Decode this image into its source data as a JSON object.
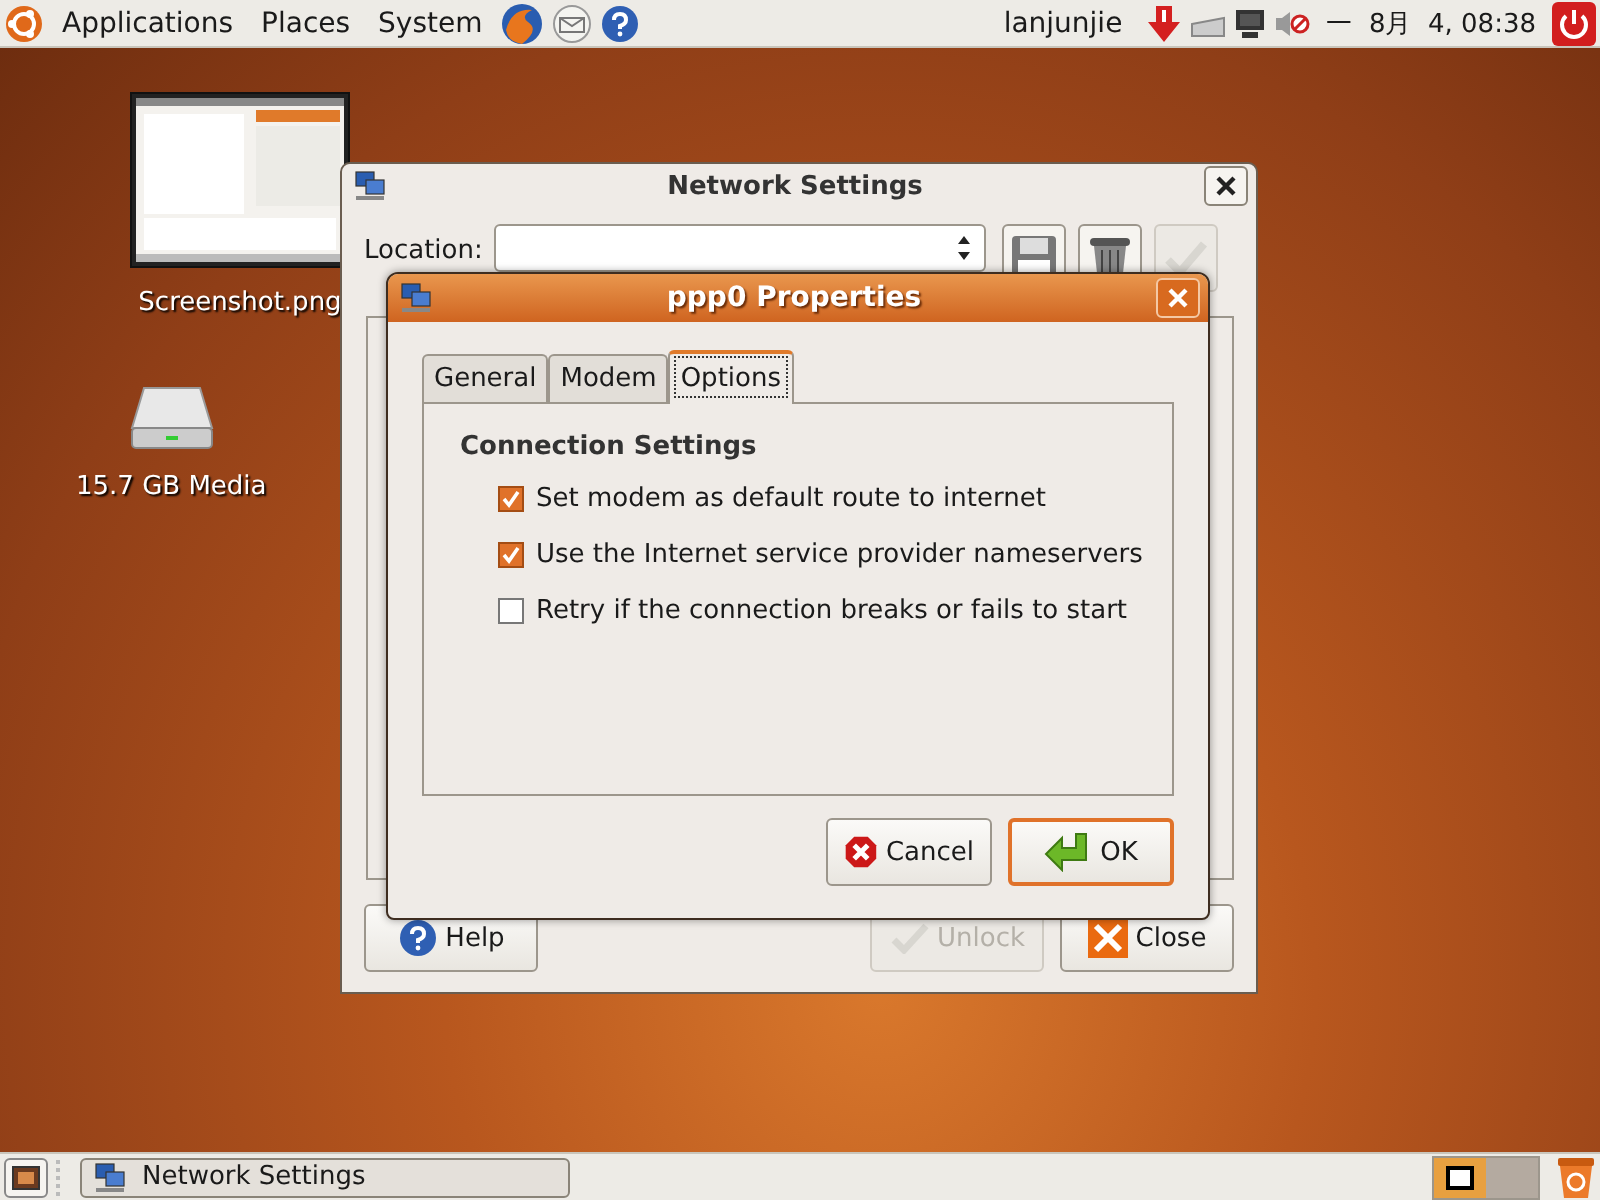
{
  "top_panel": {
    "menus": [
      "Applications",
      "Places",
      "System"
    ],
    "user": "lanjunjie",
    "clock": "一  8月  4, 08:38"
  },
  "desktop_icons": [
    {
      "label": "Screenshot.png",
      "kind": "picture"
    },
    {
      "label": "15.7 GB Media",
      "kind": "drive"
    }
  ],
  "network_settings": {
    "title": "Network Settings",
    "location_label": "Location:",
    "toolbar": [
      {
        "kind": "save",
        "disabled": false
      },
      {
        "kind": "delete",
        "disabled": false
      },
      {
        "kind": "apply",
        "disabled": true
      }
    ],
    "buttons": [
      {
        "label": "Help",
        "kind": "help",
        "disabled": false
      },
      {
        "label": "Unlock",
        "kind": "unlock",
        "disabled": true
      },
      {
        "label": "Close",
        "kind": "close",
        "disabled": false
      }
    ]
  },
  "ppp0_dialog": {
    "title": "ppp0 Properties",
    "tabs": [
      {
        "label": "General",
        "selected": false
      },
      {
        "label": "Modem",
        "selected": false
      },
      {
        "label": "Options",
        "selected": true
      }
    ],
    "section": "Connection Settings",
    "options": [
      {
        "label": "Set modem as default route to internet",
        "checked": true
      },
      {
        "label": "Use the Internet service provider nameservers",
        "checked": true
      },
      {
        "label": "Retry if the connection breaks or fails to start",
        "checked": false
      }
    ],
    "buttons": [
      {
        "label": "Cancel",
        "kind": "cancel",
        "default": false
      },
      {
        "label": "OK",
        "kind": "ok",
        "default": true
      }
    ]
  },
  "taskbar": {
    "tasks": [
      {
        "label": "Network Settings",
        "selected": false
      }
    ],
    "workspaces": [
      {
        "selected": true
      },
      {
        "selected": false
      }
    ]
  }
}
